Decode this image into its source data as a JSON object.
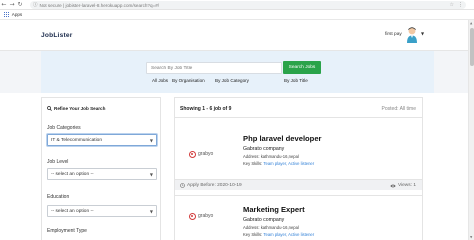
{
  "browser": {
    "url": "Not secure | jobister-laravel-8.herokuapp.com/search?q=#/",
    "bookmarks_apps_label": "Apps",
    "back_icon": "arrow-left-icon",
    "forward_icon": "arrow-right-icon",
    "reload_icon": "reload-icon"
  },
  "header": {
    "brand": "JobLister",
    "user_name": "first pay"
  },
  "search": {
    "placeholder": "Search By Job Title",
    "button_label": "Search Jobs",
    "filters": [
      "All Jobs",
      "By Organisation",
      "By Job Category",
      "By Job Title"
    ]
  },
  "sidebar": {
    "title": "Refine Your Job Search",
    "job_categories_label": "Job Categories",
    "job_categories_value": "IT & Telecommunication",
    "job_level_label": "Job Level",
    "job_level_value": "-- select an option --",
    "education_label": "Education",
    "education_value": "-- select an option --",
    "employment_type_label": "Employment Type"
  },
  "results": {
    "showing": "Showing 1 - 6 job of 9",
    "posted": "Posted: All time",
    "jobs": [
      {
        "title": "Php laravel developer",
        "company": "Gabrato company",
        "address": "Address: kathmandu-16,nepal",
        "skills_label": "Key Skills:",
        "skills": "Team player, Active listener",
        "logo_text": "grabyo",
        "apply_before": "Apply Before: 2020-10-19",
        "views": "Views: 1"
      },
      {
        "title": "Marketing Expert",
        "company": "Gabrato company",
        "address": "Address: kathmandu-16,nepal",
        "skills_label": "Key Skills:",
        "skills": "Team player, Active listener",
        "logo_text": "grabyo"
      }
    ]
  },
  "colors": {
    "accent_green": "#2aa34a",
    "hero_bg": "#e7f1fa",
    "logo_red": "#d23b3b",
    "link_blue": "#2f7fd6"
  }
}
